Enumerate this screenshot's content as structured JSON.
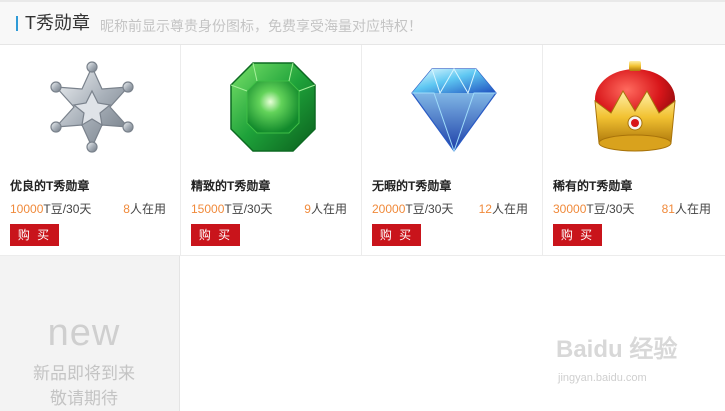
{
  "header": {
    "title": "T秀勋章",
    "subtitle": "昵称前显示尊贵身份图标，免费享受海量对应特权！"
  },
  "badges": [
    {
      "name": "优良的T秀勋章",
      "price_num": "10000",
      "price_unit": "T豆/30天",
      "users_num": "8",
      "users_unit": "人在用",
      "buy": "购 买",
      "icon": "star-badge-icon"
    },
    {
      "name": "精致的T秀勋章",
      "price_num": "15000",
      "price_unit": "T豆/30天",
      "users_num": "9",
      "users_unit": "人在用",
      "buy": "购 买",
      "icon": "emerald-icon"
    },
    {
      "name": "无暇的T秀勋章",
      "price_num": "20000",
      "price_unit": "T豆/30天",
      "users_num": "12",
      "users_unit": "人在用",
      "buy": "购 买",
      "icon": "diamond-icon"
    },
    {
      "name": "稀有的T秀勋章",
      "price_num": "30000",
      "price_unit": "T豆/30天",
      "users_num": "81",
      "users_unit": "人在用",
      "buy": "购 买",
      "icon": "crown-icon"
    }
  ],
  "coming_soon": {
    "big": "new",
    "line1": "新品即将到来",
    "line2": "敬请期待"
  },
  "watermark": {
    "logo": "Baidu 经验",
    "url": "jingyan.baidu.com"
  },
  "colors": {
    "accent": "#2f9bd7",
    "buy_button": "#c9141b",
    "number_highlight": "#f08a3b"
  }
}
